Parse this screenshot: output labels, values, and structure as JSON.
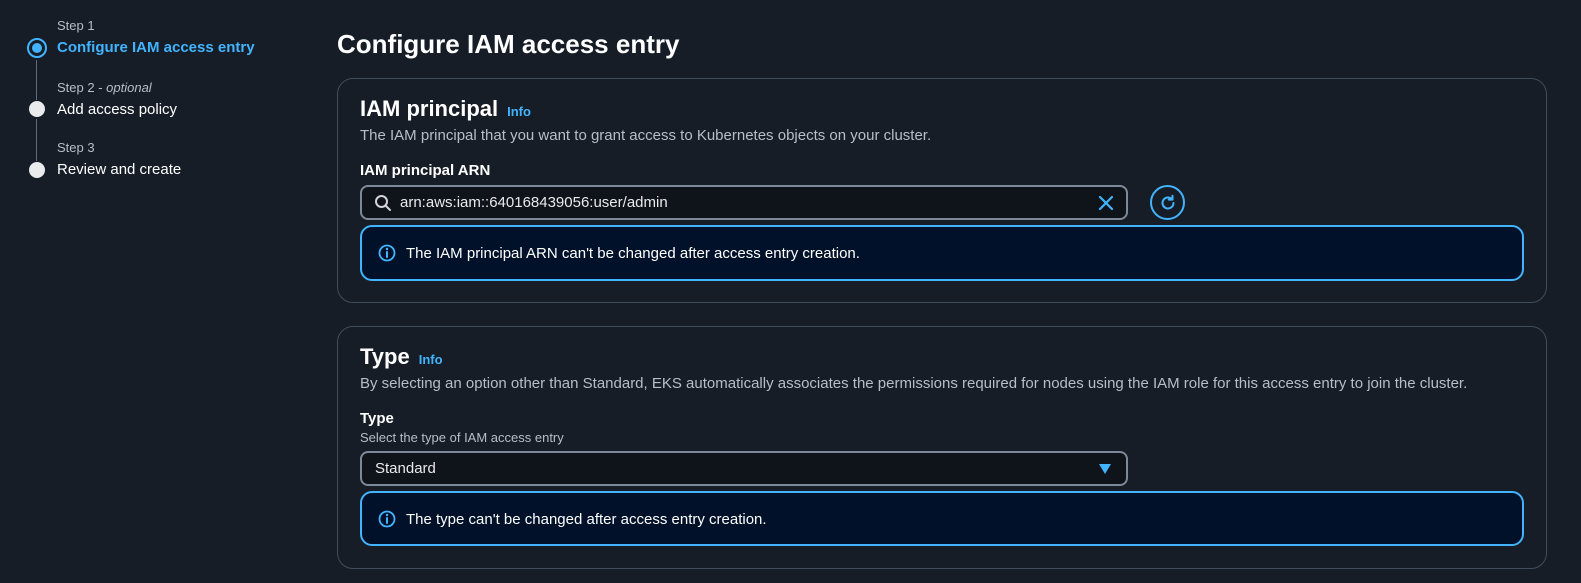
{
  "wizard": {
    "steps": [
      {
        "number": "Step 1",
        "optional": "",
        "title": "Configure IAM access entry"
      },
      {
        "number": "Step 2",
        "optional": "optional",
        "title": "Add access policy"
      },
      {
        "number": "Step 3",
        "optional": "",
        "title": "Review and create"
      }
    ],
    "optional_separator": " - "
  },
  "page": {
    "title": "Configure IAM access entry"
  },
  "principal_panel": {
    "heading": "IAM principal",
    "info_link": "Info",
    "description": "The IAM principal that you want to grant access to Kubernetes objects on your cluster.",
    "field_label": "IAM principal ARN",
    "arn_value": "arn:aws:iam::640168439056:user/admin",
    "alert_text": "The IAM principal ARN can't be changed after access entry creation."
  },
  "type_panel": {
    "heading": "Type",
    "info_link": "Info",
    "description": "By selecting an option other than Standard, EKS automatically associates the permissions required for nodes using the IAM role for this access entry to join the cluster.",
    "field_label": "Type",
    "field_description": "Select the type of IAM access entry",
    "selected_value": "Standard",
    "alert_text": "The type can't be changed after access entry creation."
  },
  "colors": {
    "background": "#161d26",
    "accent": "#42b4ff",
    "alert_background": "#001129",
    "border": "#414d5c"
  },
  "icons": {
    "search": "search-icon",
    "clear": "close-icon",
    "refresh": "refresh-icon",
    "info": "info-icon",
    "caret": "caret-down-icon"
  }
}
